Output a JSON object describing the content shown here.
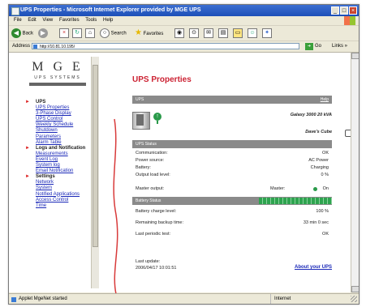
{
  "window": {
    "title": "UPS Properties - Microsoft Internet Explorer provided by MGE UPS",
    "controls": {
      "minimize": "_",
      "maximize": "□",
      "close": "×"
    }
  },
  "menu": {
    "items": [
      "File",
      "Edit",
      "View",
      "Favorites",
      "Tools",
      "Help"
    ]
  },
  "toolbar": {
    "back_label": "Back",
    "search_label": "Search",
    "favorites_label": "Favorites"
  },
  "address": {
    "label": "Address",
    "url": "http://10.81.10.195/",
    "go_label": "Go",
    "links_label": "Links »"
  },
  "brand": {
    "logo_main": "M G E",
    "logo_sub": "UPS SYSTEMS"
  },
  "nav": {
    "sections": [
      {
        "title": "UPS",
        "links": [
          "UPS Properties",
          "3-Phase Display",
          "UPS Control",
          "Weekly Schedule",
          "Shutdown",
          "Parameters",
          "Alarm Table"
        ]
      },
      {
        "title": "Logs and Notification",
        "links": [
          "Measurements",
          "Event Log",
          "System log",
          "Email Notification"
        ]
      },
      {
        "title": "Settings",
        "links": [
          "Network",
          "System",
          "Notified Applications",
          "Access Control",
          "Time"
        ]
      }
    ]
  },
  "main": {
    "title": "UPS Properties",
    "ups_section": {
      "header": "UPS",
      "help_link": "Help",
      "model": "Galaxy 3000 20 kVA",
      "owner": "Dave's Cube"
    },
    "status_section": {
      "header": "UPS Status",
      "rows": [
        {
          "label": "Communication:",
          "value": "OK"
        },
        {
          "label": "Power source:",
          "value": "AC Power"
        },
        {
          "label": "Battery:",
          "value": "Charging"
        },
        {
          "label": "Output load level:",
          "value": "0 %"
        },
        {
          "label": "Master output:",
          "mid": "Master:",
          "value": "On"
        }
      ]
    },
    "battery_section": {
      "header": "Battery Status",
      "charge_fraction": 1.0,
      "rows": [
        {
          "label": "Battery charge level:",
          "value": "100 %"
        },
        {
          "label": "Remaining backup time:",
          "value": "33 min 0 sec"
        },
        {
          "label": "Last periodic test:",
          "value": "OK"
        }
      ]
    },
    "last_update_label": "Last update:",
    "last_update_value": "2006/04/17 10:01:51",
    "about_link": "About your UPS"
  },
  "statusbar": {
    "text": "Applet MgeNet started",
    "zone": "Internet"
  },
  "colors": {
    "accent_red": "#cc2233",
    "link_blue": "#1a28b8",
    "status_green": "#2a9a4a"
  }
}
